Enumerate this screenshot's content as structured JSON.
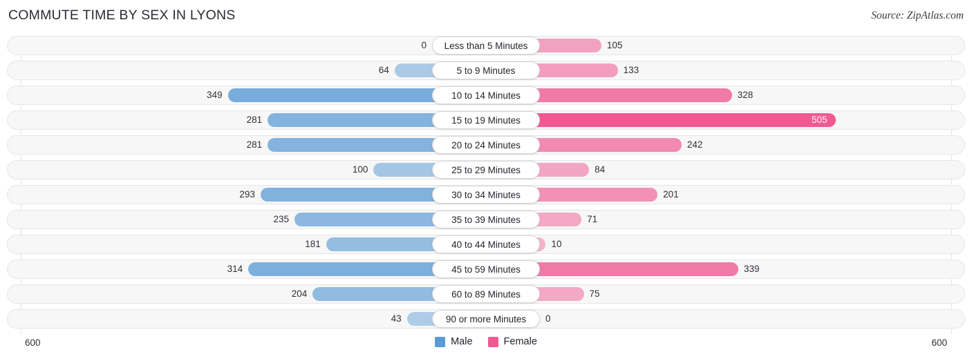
{
  "header": {
    "title": "COMMUTE TIME BY SEX IN LYONS",
    "source": "Source: ZipAtlas.com"
  },
  "axis": {
    "left_label": "600",
    "right_label": "600"
  },
  "legend": {
    "items": [
      {
        "label": "Male",
        "color": "#5b9bd5"
      },
      {
        "label": "Female",
        "color": "#ef5a92"
      }
    ]
  },
  "chart_data": {
    "type": "bar",
    "subtype": "diverging-bar",
    "title": "COMMUTE TIME BY SEX IN LYONS",
    "xlabel": "",
    "ylabel": "",
    "axis_max_per_side": 600,
    "grid": false,
    "legend_position": "bottom-center",
    "categories": [
      "Less than 5 Minutes",
      "5 to 9 Minutes",
      "10 to 14 Minutes",
      "15 to 19 Minutes",
      "20 to 24 Minutes",
      "25 to 29 Minutes",
      "30 to 34 Minutes",
      "35 to 39 Minutes",
      "40 to 44 Minutes",
      "45 to 59 Minutes",
      "60 to 89 Minutes",
      "90 or more Minutes"
    ],
    "series": [
      {
        "name": "Male",
        "direction": "left",
        "color": "#5b9bd5",
        "values": [
          0,
          64,
          349,
          281,
          281,
          100,
          293,
          235,
          181,
          314,
          204,
          43
        ]
      },
      {
        "name": "Female",
        "direction": "right",
        "color": "#ef5a92",
        "values": [
          105,
          133,
          328,
          505,
          242,
          84,
          201,
          71,
          10,
          339,
          75,
          0
        ]
      }
    ],
    "rows": [
      {
        "category": "Less than 5 Minutes",
        "male": 0,
        "female": 105,
        "female_label_inside": false
      },
      {
        "category": "5 to 9 Minutes",
        "male": 64,
        "female": 133,
        "female_label_inside": false
      },
      {
        "category": "10 to 14 Minutes",
        "male": 349,
        "female": 328,
        "female_label_inside": false
      },
      {
        "category": "15 to 19 Minutes",
        "male": 281,
        "female": 505,
        "female_label_inside": true
      },
      {
        "category": "20 to 24 Minutes",
        "male": 281,
        "female": 242,
        "female_label_inside": false
      },
      {
        "category": "25 to 29 Minutes",
        "male": 100,
        "female": 84,
        "female_label_inside": false
      },
      {
        "category": "30 to 34 Minutes",
        "male": 293,
        "female": 201,
        "female_label_inside": false
      },
      {
        "category": "35 to 39 Minutes",
        "male": 235,
        "female": 71,
        "female_label_inside": false
      },
      {
        "category": "40 to 44 Minutes",
        "male": 181,
        "female": 10,
        "female_label_inside": false
      },
      {
        "category": "45 to 59 Minutes",
        "male": 314,
        "female": 339,
        "female_label_inside": false
      },
      {
        "category": "60 to 89 Minutes",
        "male": 204,
        "female": 75,
        "female_label_inside": false
      },
      {
        "category": "90 or more Minutes",
        "male": 43,
        "female": 0,
        "female_label_inside": false
      }
    ]
  }
}
